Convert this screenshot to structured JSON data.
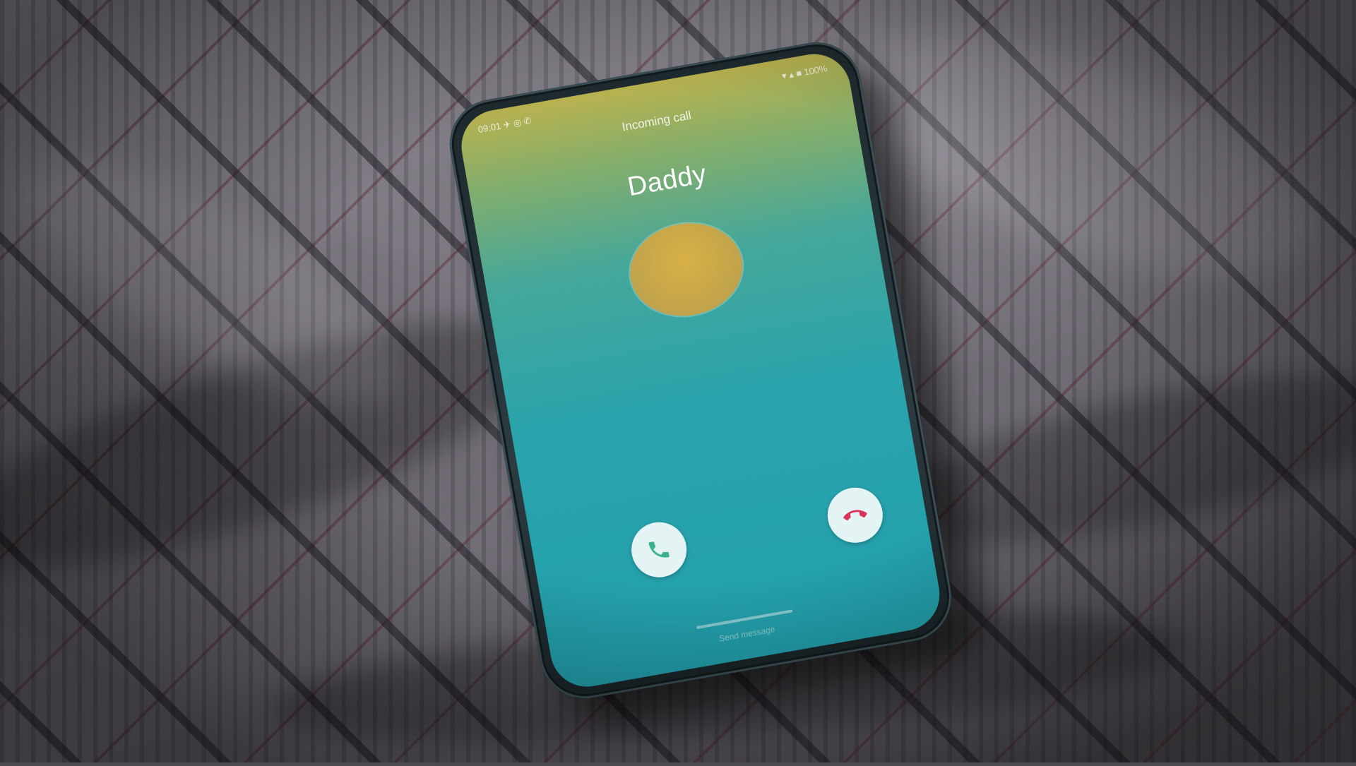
{
  "status_bar": {
    "left": "09:01 ✈ ◎ ✆",
    "right": "▾ ▴ ■ 100%"
  },
  "call": {
    "header": "Incoming call",
    "caller_name": "Daddy",
    "bottom_label": "Send message"
  },
  "buttons": {
    "answer_icon": "phone-answer-icon",
    "decline_icon": "phone-decline-icon"
  },
  "colors": {
    "answer": "#3ab38a",
    "decline": "#d9345a",
    "avatar": "#d4ad48",
    "screen_top": "#b9b24f",
    "screen_bottom": "#22a0ac"
  }
}
